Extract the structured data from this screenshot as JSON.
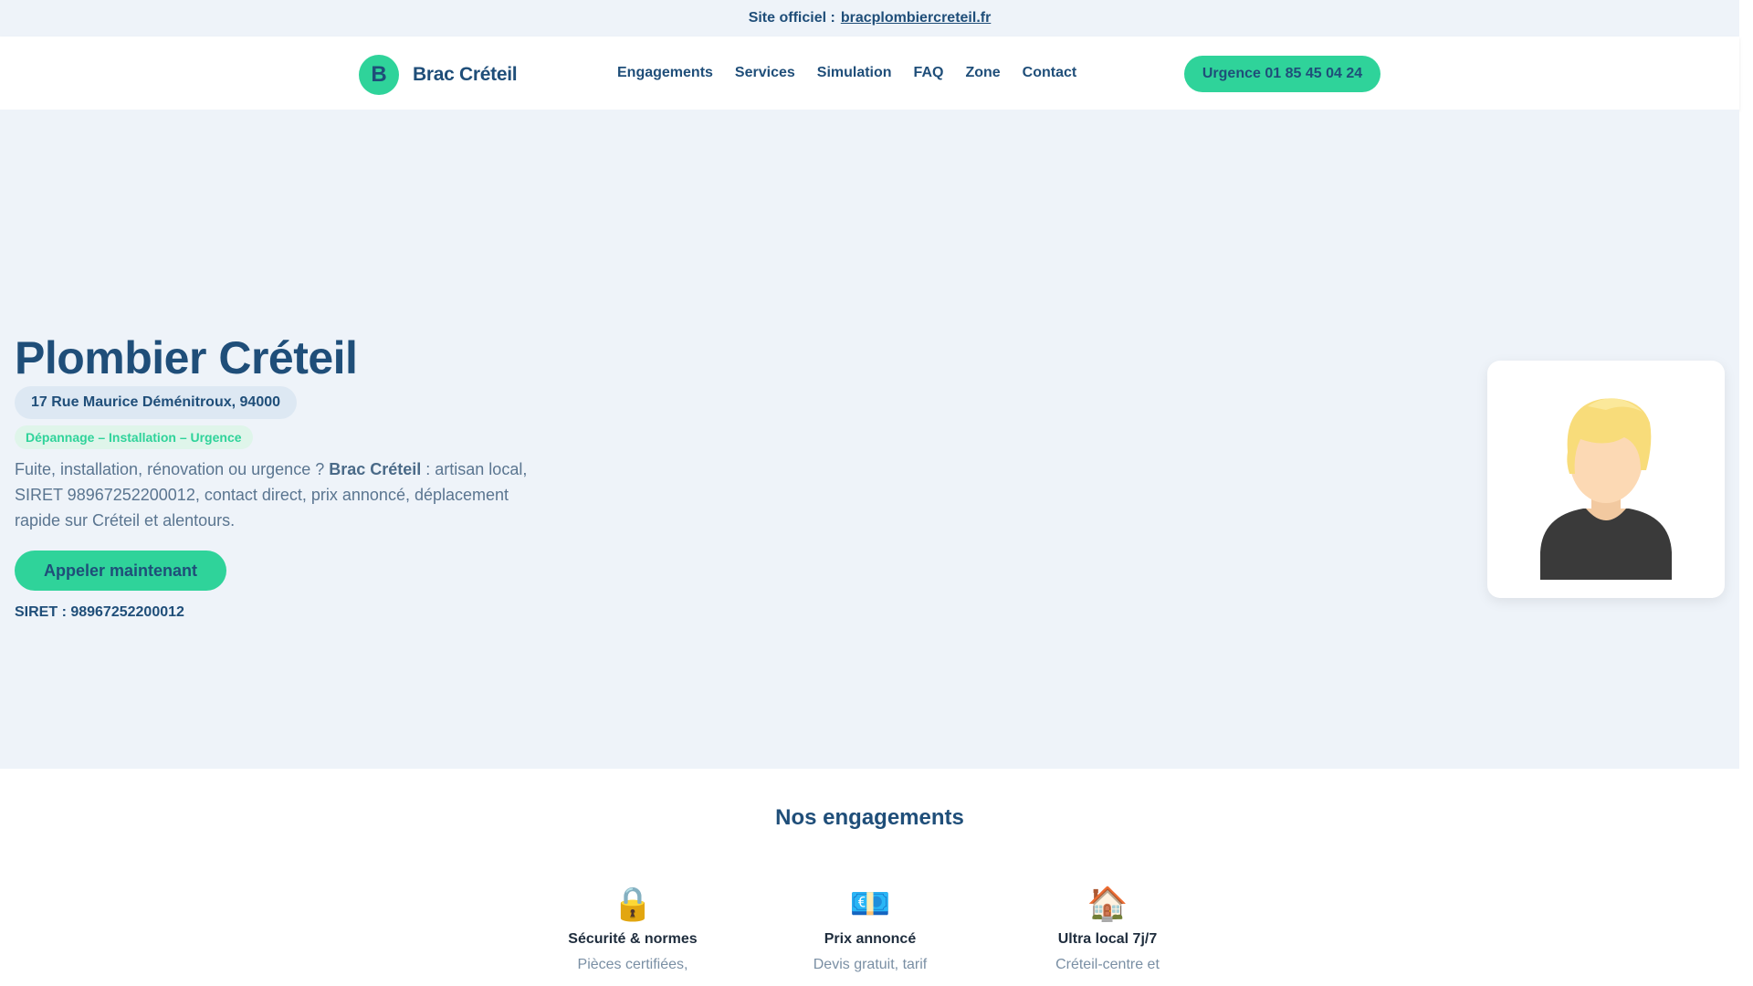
{
  "topbar": {
    "label": "Site officiel :",
    "link": "bracplombiercreteil.fr"
  },
  "header": {
    "logo_letter": "B",
    "brand": "Brac Créteil",
    "nav": [
      "Engagements",
      "Services",
      "Simulation",
      "FAQ",
      "Zone",
      "Contact"
    ],
    "urgent_button": "Urgence 01 85 45 04 24"
  },
  "hero": {
    "title": "Plombier Créteil",
    "address": "17 Rue Maurice Déménitroux, 94000",
    "tag": "Dépannage – Installation – Urgence",
    "intro_pre": "Fuite, installation, rénovation ou urgence ? ",
    "intro_brand": "Brac Créteil",
    "intro_post": " : artisan local, SIRET 98967252200012, contact direct, prix annoncé, déplacement rapide sur Créteil et alentours.",
    "call_button": "Appeler maintenant",
    "siret": "SIRET : 98967252200012",
    "avatar_icon": "user-avatar-icon"
  },
  "engagements": {
    "title": "Nos engagements",
    "items": [
      {
        "icon": "lock-icon",
        "glyph": "🔒",
        "title": "Sécurité & normes",
        "desc": "Pièces certifiées,"
      },
      {
        "icon": "money-icon",
        "glyph": "💶",
        "title": "Prix annoncé",
        "desc": "Devis gratuit, tarif"
      },
      {
        "icon": "house-icon",
        "glyph": "🏠",
        "title": "Ultra local 7j/7",
        "desc": "Créteil-centre et"
      }
    ]
  },
  "colors": {
    "accent": "#2fd39a",
    "primary": "#1f4e79",
    "hero_bg": "#eef3f9"
  }
}
